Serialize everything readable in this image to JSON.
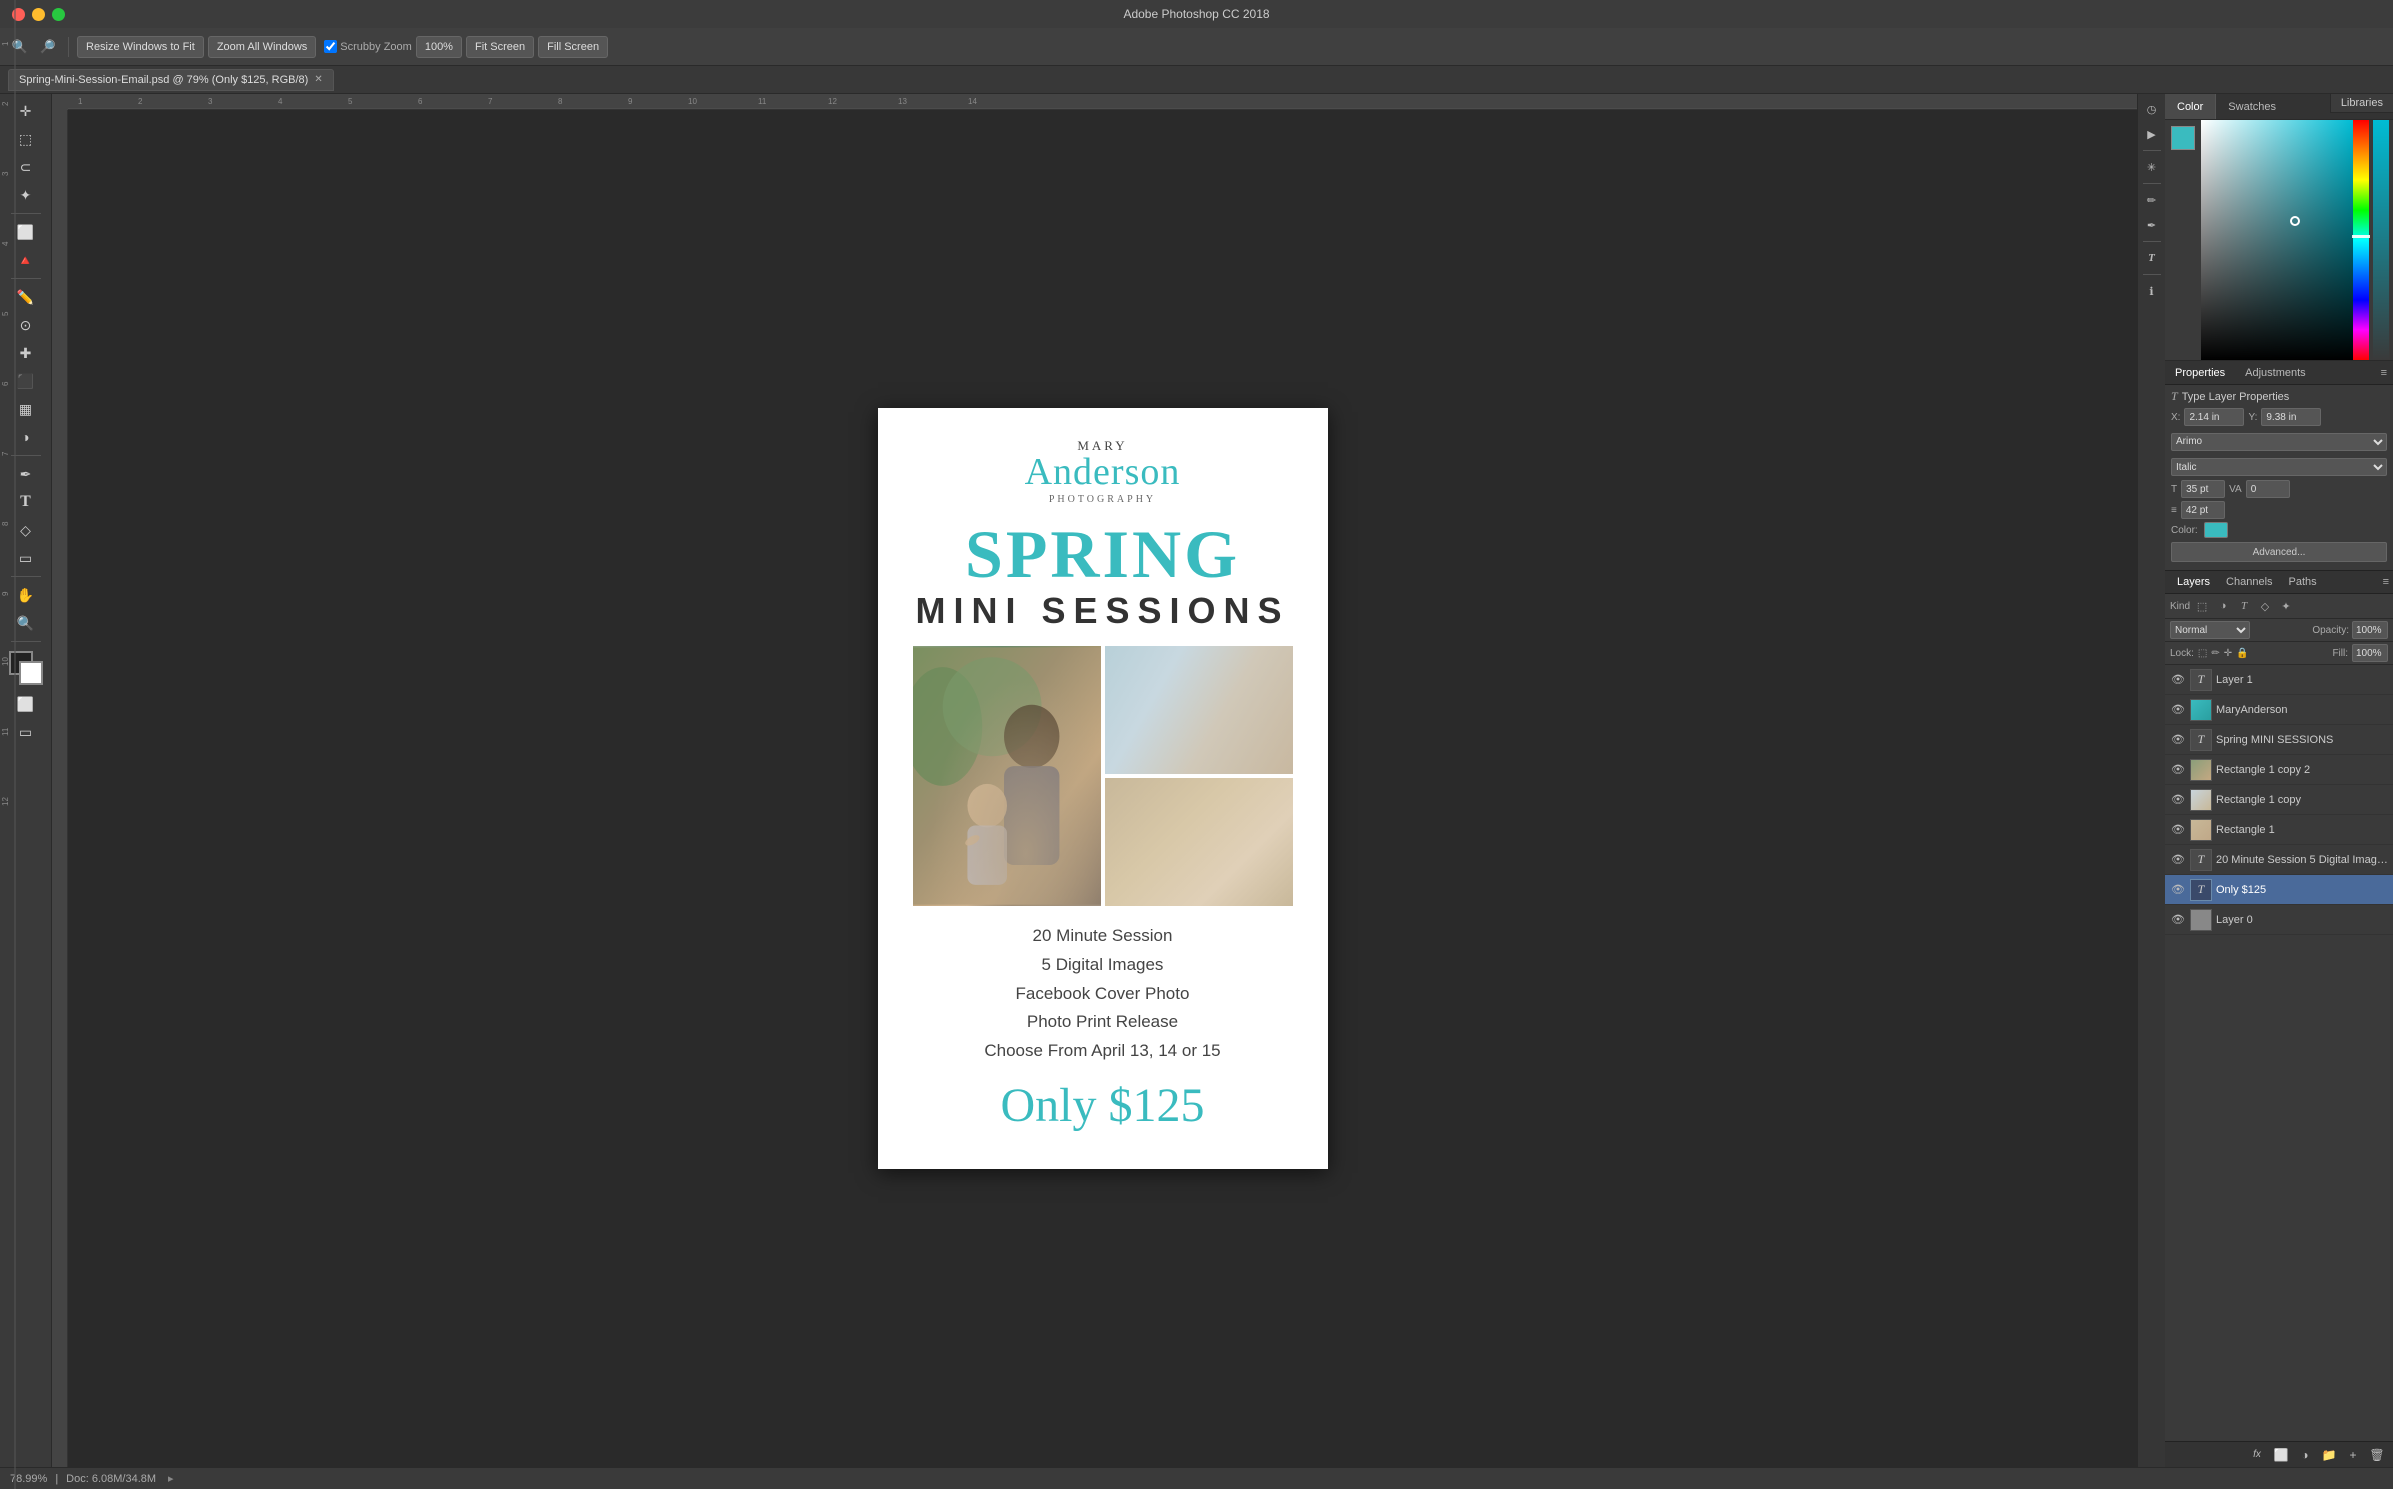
{
  "app": {
    "title": "Adobe Photoshop CC 2018",
    "tab_label": "Spring-Mini-Session-Email.psd @ 79% (Only $125, RGB/8)",
    "zoom": "79%",
    "doc_info": "Doc: 6.08M/34.8M"
  },
  "toolbar": {
    "tools": [
      "🔍",
      "🔍",
      "✂️",
      "⬚",
      "⊕",
      "⊖",
      "✏️",
      "T",
      "⬜"
    ],
    "buttons": [
      "Resize Windows to Fit",
      "Zoom All Windows",
      "Scrubby Zoom",
      "100%",
      "Fit Screen",
      "Fill Screen"
    ]
  },
  "document": {
    "brand_mary": "MARY",
    "brand_anderson": "Anderson",
    "brand_photography": "PHOTOGRAPHY",
    "spring_text": "SPRING",
    "mini_sessions_text": "MINI SESSIONS",
    "services": [
      "20 Minute Session",
      "5 Digital Images",
      "Facebook Cover Photo",
      "Photo Print Release",
      "Choose From April 13, 14 or 15"
    ],
    "price": "Only $125"
  },
  "color_panel": {
    "tab_color": "Color",
    "tab_swatches": "Swatches",
    "libraries_tab": "Libraries",
    "color_value": "#3ABBBF"
  },
  "properties_panel": {
    "tab_properties": "Properties",
    "tab_adjustments": "Adjustments",
    "section_title": "Type Layer Properties",
    "x_label": "X:",
    "x_value": "2.14 in",
    "y_label": "Y:",
    "y_value": "9.38 in",
    "font_family": "Arimo",
    "font_style": "Italic",
    "font_size": "35 pt",
    "tracking": "0",
    "leading": "42 pt",
    "color_label": "Color:",
    "advanced_label": "Advanced..."
  },
  "layers_panel": {
    "tab_layers": "Layers",
    "tab_channels": "Channels",
    "tab_paths": "Paths",
    "filter_label": "Kind",
    "blend_mode": "Normal",
    "opacity_label": "Opacity:",
    "opacity_value": "100%",
    "lock_label": "Lock:",
    "fill_label": "Fill:",
    "fill_value": "100%",
    "layers": [
      {
        "name": "Layer 1",
        "type": "text",
        "visible": true,
        "active": false
      },
      {
        "name": "MaryAnderson",
        "type": "image",
        "visible": true,
        "active": false
      },
      {
        "name": "Spring MINI SESSIONS",
        "type": "text",
        "visible": true,
        "active": false
      },
      {
        "name": "Rectangle 1 copy 2",
        "type": "image",
        "visible": true,
        "active": false
      },
      {
        "name": "Rectangle 1 copy",
        "type": "image",
        "visible": true,
        "active": false
      },
      {
        "name": "Rectangle 1",
        "type": "image",
        "visible": true,
        "active": false
      },
      {
        "name": "20 Minute Session 5 Digital Images ...",
        "type": "text",
        "visible": true,
        "active": false
      },
      {
        "name": "Only $125",
        "type": "text",
        "visible": true,
        "active": true
      },
      {
        "name": "Layer 0",
        "type": "image",
        "visible": true,
        "active": false
      }
    ],
    "bottom_icons": [
      "fx",
      "⬜",
      "⬜",
      "⬜",
      "🗑"
    ]
  },
  "status_bar": {
    "zoom": "78.99%",
    "doc_info": "Doc: 6.08M/34.8M"
  }
}
